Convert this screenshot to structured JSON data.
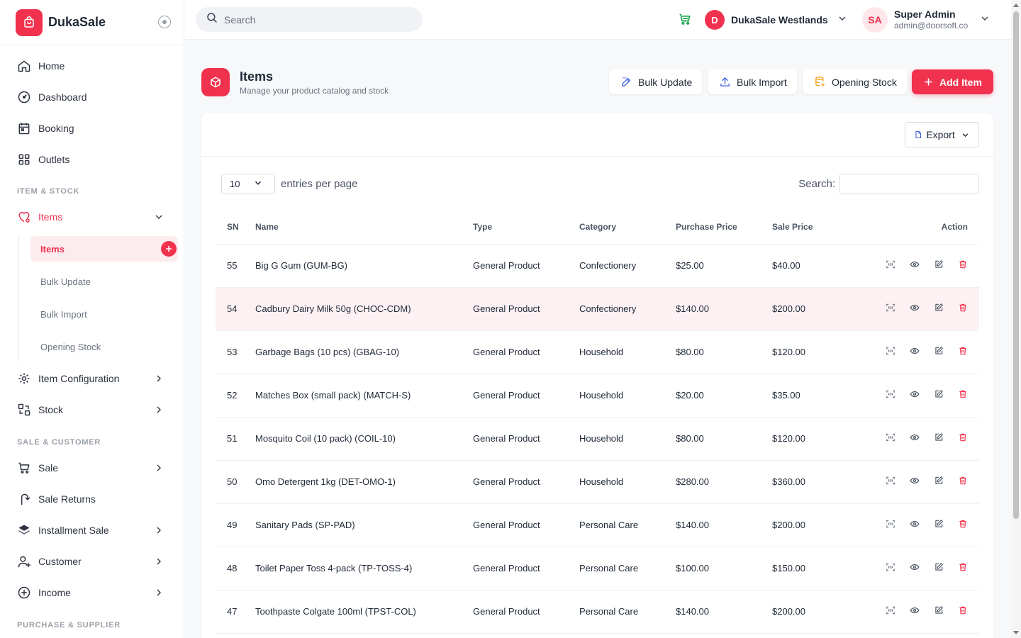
{
  "brand": {
    "name": "DukaSale"
  },
  "sidebar": {
    "home": "Home",
    "dashboard": "Dashboard",
    "booking": "Booking",
    "outlets": "Outlets",
    "section_item_stock": "ITEM & STOCK",
    "items": "Items",
    "sub_items": [
      "Items",
      "Bulk Update",
      "Bulk Import",
      "Opening Stock"
    ],
    "item_configuration": "Item Configuration",
    "stock": "Stock",
    "section_sale_customer": "SALE & CUSTOMER",
    "sale": "Sale",
    "sale_returns": "Sale Returns",
    "installment_sale": "Installment Sale",
    "customer": "Customer",
    "income": "Income",
    "section_purchase_supplier": "PURCHASE & SUPPLIER"
  },
  "topbar": {
    "search_placeholder": "Search",
    "outlet_initial": "D",
    "outlet_name": "DukaSale Westlands",
    "user_initials": "SA",
    "user_name": "Super Admin",
    "user_email": "admin@doorsoft.co"
  },
  "page": {
    "title": "Items",
    "subtitle": "Manage your product catalog and stock",
    "bulk_update": "Bulk Update",
    "bulk_import": "Bulk Import",
    "opening_stock": "Opening Stock",
    "add_item": "Add Item"
  },
  "table_controls": {
    "export": "Export",
    "entries_value": "10",
    "entries_label": "entries per page",
    "search_label": "Search:"
  },
  "table": {
    "headers": [
      "SN",
      "Name",
      "Type",
      "Category",
      "Purchase Price",
      "Sale Price",
      "Action"
    ],
    "rows": [
      [
        "55",
        "Big G Gum (GUM-BG)",
        "General Product",
        "Confectionery",
        "$25.00",
        "$40.00"
      ],
      [
        "54",
        "Cadbury Dairy Milk 50g (CHOC-CDM)",
        "General Product",
        "Confectionery",
        "$140.00",
        "$200.00"
      ],
      [
        "53",
        "Garbage Bags (10 pcs) (GBAG-10)",
        "General Product",
        "Household",
        "$80.00",
        "$120.00"
      ],
      [
        "52",
        "Matches Box (small pack) (MATCH-S)",
        "General Product",
        "Household",
        "$20.00",
        "$35.00"
      ],
      [
        "51",
        "Mosquito Coil (10 pack) (COIL-10)",
        "General Product",
        "Household",
        "$80.00",
        "$120.00"
      ],
      [
        "50",
        "Omo Detergent 1kg (DET-OMO-1)",
        "General Product",
        "Household",
        "$280.00",
        "$360.00"
      ],
      [
        "49",
        "Sanitary Pads (SP-PAD)",
        "General Product",
        "Personal Care",
        "$140.00",
        "$200.00"
      ],
      [
        "48",
        "Toilet Paper Toss 4-pack (TP-TOSS-4)",
        "General Product",
        "Personal Care",
        "$100.00",
        "$150.00"
      ],
      [
        "47",
        "Toothpaste Colgate 100ml (TPST-COL)",
        "General Product",
        "Personal Care",
        "$140.00",
        "$200.00"
      ]
    ]
  },
  "colors": {
    "accent": "#f0324f",
    "accent_soft": "#fdecee",
    "cart_green": "#16a34a",
    "opening_stock_orange": "#f59e0b"
  },
  "icons": {
    "action_icons": [
      "barcode-icon",
      "eye-icon",
      "edit-icon",
      "trash-icon"
    ]
  }
}
